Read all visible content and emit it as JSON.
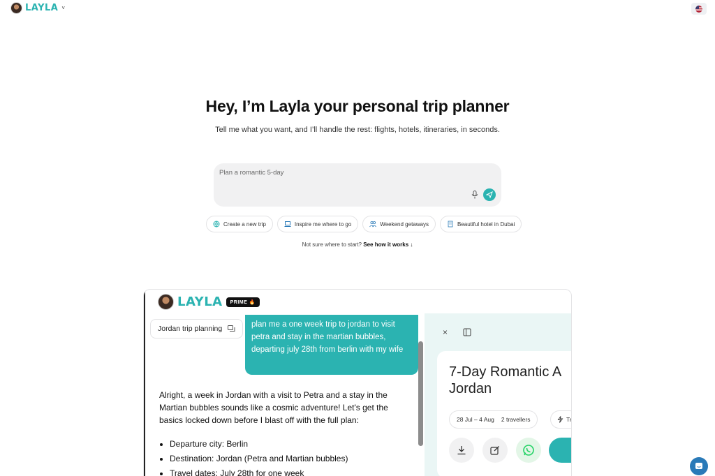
{
  "header": {
    "brand_name": "LAYLA",
    "brand_chevron": "˅",
    "language_flag": "flag-us-icon"
  },
  "hero": {
    "title": "Hey, I’m Layla your personal trip planner",
    "subtitle": "Tell me what you want, and I’ll handle the rest: flights, hotels, itineraries, in seconds."
  },
  "prompt": {
    "value": "Plan a romantic 5-day",
    "mic_icon": "microphone-icon",
    "send_icon": "send-icon"
  },
  "suggestions": [
    {
      "label": "Create a new trip",
      "icon": "globe-icon"
    },
    {
      "label": "Inspire me where to go",
      "icon": "laptop-icon"
    },
    {
      "label": "Weekend getaways",
      "icon": "people-icon"
    },
    {
      "label": "Beautiful hotel in Dubai",
      "icon": "hotel-icon"
    }
  ],
  "help_line": {
    "prefix": "Not sure where to start?",
    "link": "See how it works ↓"
  },
  "preview": {
    "brand_name": "LAYLA",
    "prime_label": "PRIME",
    "prime_fire": "🔥",
    "trip_pill": "Jordan trip planning",
    "user_message": "plan me a one week trip to jordan to visit petra and stay in the martian bubbles, departing july 28th from berlin with my wife",
    "assistant_intro": "Alright, a week in Jordan with a visit to Petra and a stay in the Martian bubbles sounds like a cosmic adventure! Let's get the basics locked down before I blast off with the full plan:",
    "assistant_bullets": [
      "Departure city: Berlin",
      "Destination: Jordan (Petra and Martian bubbles)",
      "Travel dates: July 28th for one week"
    ],
    "close_glyph": "×",
    "trip_title_line1": "7-Day Romantic A",
    "trip_title_line2": "Jordan",
    "dates": "28 Jul – 4 Aug",
    "travellers": "2 travellers",
    "extra_pill": "Tr"
  },
  "colors": {
    "accent": "#2bb3b1",
    "help_button": "#2a7ab8"
  }
}
